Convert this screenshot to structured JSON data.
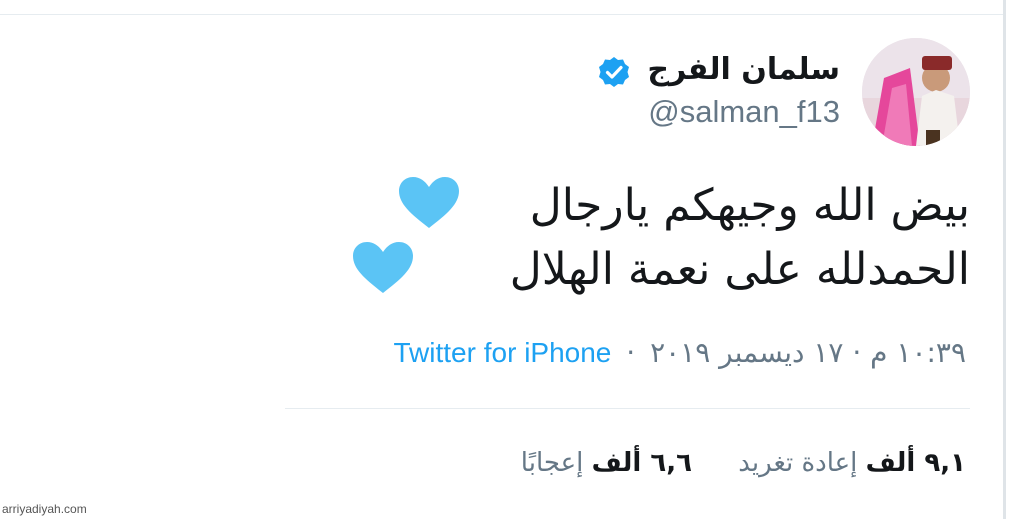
{
  "tweet": {
    "author": {
      "display_name": "سلمان الفرج",
      "handle": "@salman_f13",
      "verified": true,
      "verified_color": "#1da1f2"
    },
    "text": {
      "line1": "بيض الله وجيهكم يارجال",
      "line2": "الحمدلله على نعمة الهلال",
      "emoji": "light-blue-heart"
    },
    "meta": {
      "time_date": "١٠:٣٩ م · ١٧ ديسمبر ٢٠١٩",
      "separator": "·",
      "source": "Twitter for iPhone"
    },
    "stats": {
      "retweets_count": "٩,١ ألف",
      "retweets_label": "إعادة تغريد",
      "likes_count": "٦,٦ ألف",
      "likes_label": "إعجابًا"
    }
  },
  "watermark": "arriyadiyah.com",
  "colors": {
    "text_primary": "#14171a",
    "text_secondary": "#657786",
    "link": "#1da1f2",
    "heart": "#5bc4f5"
  }
}
